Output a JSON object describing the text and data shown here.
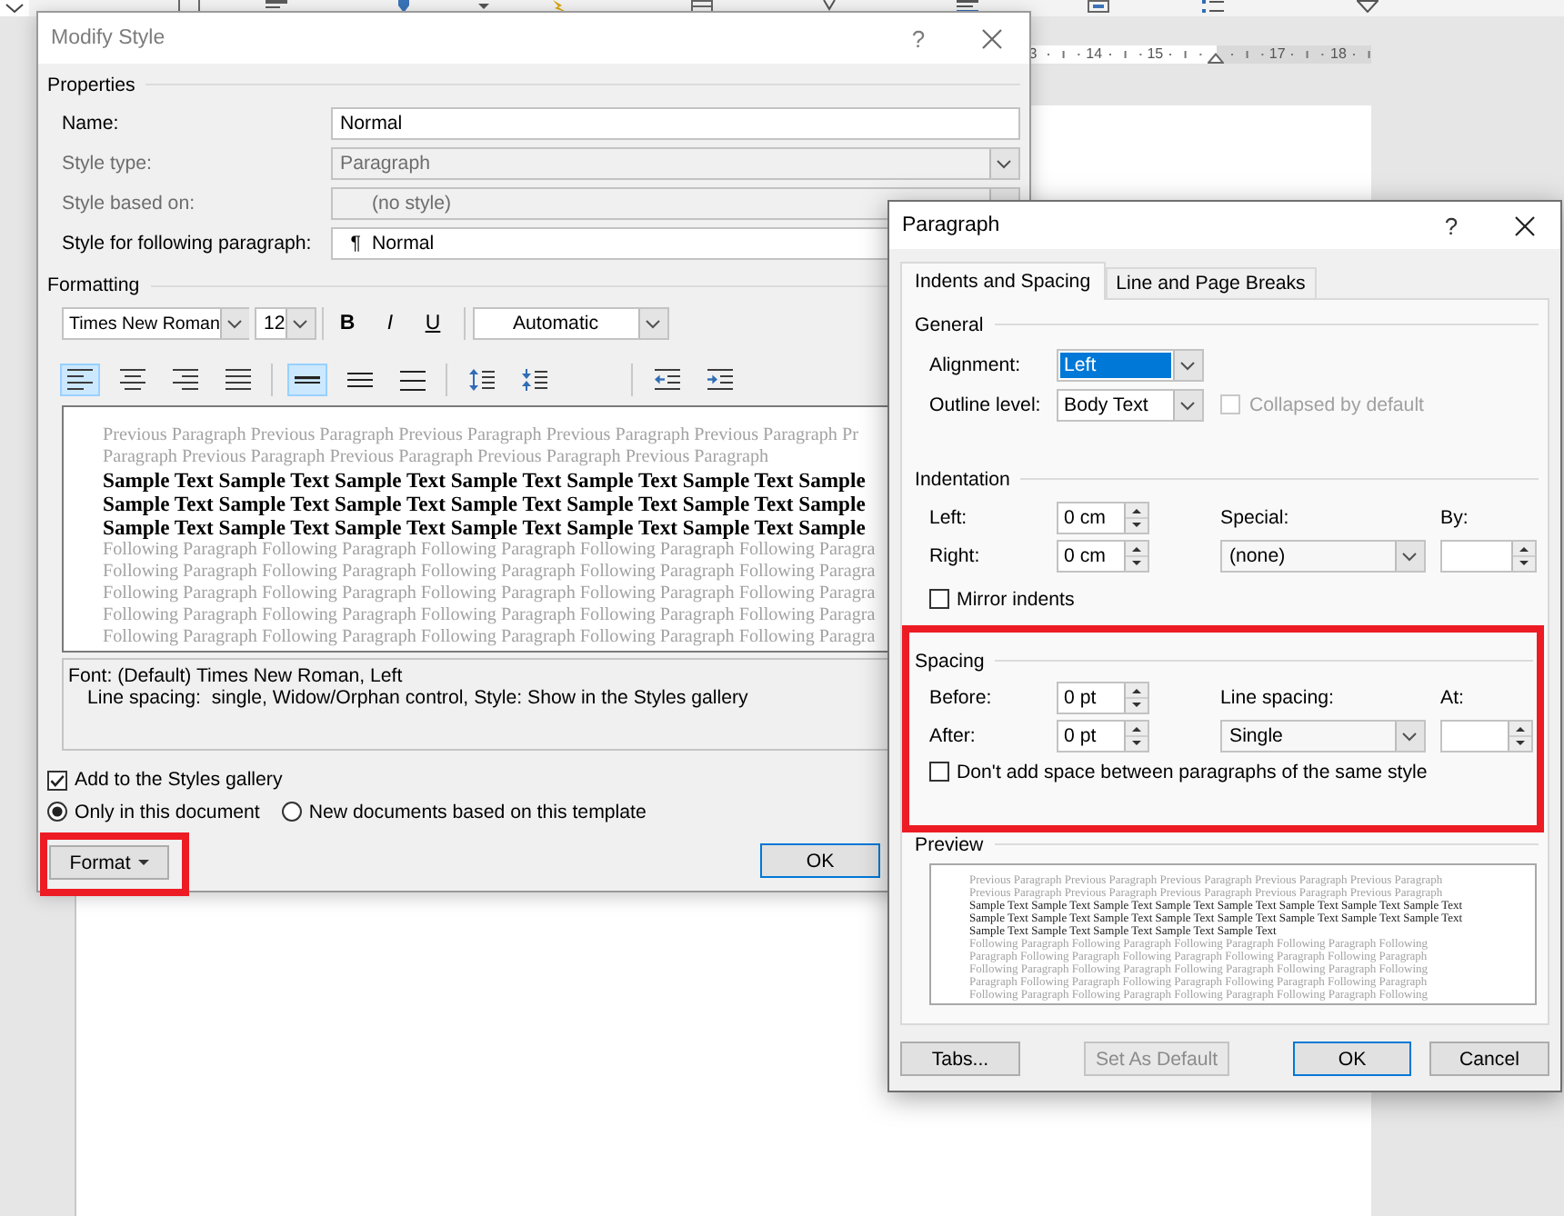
{
  "ruler": {
    "marks": [
      {
        "kind": "number",
        "text": "3"
      },
      {
        "kind": "number",
        "text": "14"
      },
      {
        "kind": "number",
        "text": "15"
      },
      {
        "kind": "indent_marker"
      },
      {
        "kind": "number",
        "text": "17"
      },
      {
        "kind": "number",
        "text": "18"
      }
    ]
  },
  "modify_style": {
    "title": "Modify Style",
    "help": "?",
    "properties": {
      "heading": "Properties",
      "fields": [
        {
          "kind": "text",
          "label": "Name:",
          "value": "Normal",
          "disabled": false
        },
        {
          "kind": "dropdown",
          "label": "Style type:",
          "value": "Paragraph",
          "disabled": true
        },
        {
          "kind": "style_dropdown",
          "label": "Style based on:",
          "value": "(no style)",
          "disabled": true
        },
        {
          "kind": "style_dropdown",
          "label": "Style for following paragraph:",
          "mark": "¶",
          "value": "Normal",
          "disabled": false
        }
      ]
    },
    "formatting": {
      "heading": "Formatting",
      "font": "Times New Roman",
      "size": "12",
      "styles": [
        {
          "kind": "bold",
          "label": "B"
        },
        {
          "kind": "italic",
          "label": "I"
        },
        {
          "kind": "underline",
          "label": "U"
        }
      ],
      "font_shade": "Automatic",
      "alignment": [
        {
          "kind": "left",
          "selected": true
        },
        {
          "kind": "center",
          "selected": false
        },
        {
          "kind": "right",
          "selected": false
        },
        {
          "kind": "justify",
          "selected": false
        }
      ],
      "line_spacing": [
        {
          "kind": "single",
          "selected": true
        },
        {
          "kind": "one_and_half",
          "selected": false
        },
        {
          "kind": "double",
          "selected": false
        }
      ],
      "spacing": [
        {
          "kind": "increase"
        },
        {
          "kind": "decrease"
        }
      ],
      "indent": [
        {
          "kind": "decrease"
        },
        {
          "kind": "increase"
        }
      ]
    },
    "preview": {
      "lines": [
        {
          "kind": "previous",
          "text": "Previous Paragraph Previous Paragraph Previous Paragraph Previous Paragraph Previous Paragraph Pr"
        },
        {
          "kind": "previous",
          "text": "Paragraph Previous Paragraph Previous Paragraph Previous Paragraph Previous Paragraph"
        },
        {
          "kind": "sample",
          "text": "Sample Text Sample Text Sample Text Sample Text Sample Text Sample Text Sample"
        },
        {
          "kind": "sample",
          "text": "Sample Text Sample Text Sample Text Sample Text Sample Text Sample Text Sample"
        },
        {
          "kind": "sample",
          "text": "Sample Text Sample Text Sample Text Sample Text Sample Text Sample Text Sample"
        },
        {
          "kind": "following",
          "text": "Following Paragraph Following Paragraph Following Paragraph Following Paragraph Following Paragra"
        },
        {
          "kind": "following",
          "text": "Following Paragraph Following Paragraph Following Paragraph Following Paragraph Following Paragra"
        },
        {
          "kind": "following",
          "text": "Following Paragraph Following Paragraph Following Paragraph Following Paragraph Following Paragra"
        },
        {
          "kind": "following",
          "text": "Following Paragraph Following Paragraph Following Paragraph Following Paragraph Following Paragra"
        },
        {
          "kind": "following",
          "text": "Following Paragraph Following Paragraph Following Paragraph Following Paragraph Following Paragra"
        }
      ]
    },
    "description": [
      "Font: (Default) Times New Roman, Left",
      "Line spacing:  single, Widow/Orphan control, Style: Show in the Styles gallery"
    ],
    "add_to_gallery": {
      "label": "Add to the Styles gallery",
      "checked": true
    },
    "scope": [
      {
        "label": "Only in this document",
        "selected": true
      },
      {
        "label": "New documents based on this template",
        "selected": false
      }
    ],
    "buttons": [
      {
        "kind": "format",
        "label": "Format",
        "menu": true,
        "default": false,
        "highlighted": true
      },
      {
        "kind": "ok",
        "label": "OK",
        "default": true
      }
    ]
  },
  "paragraph": {
    "title": "Paragraph",
    "help": "?",
    "tabs": [
      {
        "label": "Indents and Spacing",
        "selected": true
      },
      {
        "label": "Line and Page Breaks",
        "selected": false
      }
    ],
    "general": {
      "heading": "General",
      "alignment": {
        "label": "Alignment:",
        "value": "Left",
        "focused": true
      },
      "outline_level": {
        "label": "Outline level:",
        "value": "Body Text"
      },
      "collapsed": {
        "label": "Collapsed by default",
        "checked": false,
        "disabled": true
      }
    },
    "indentation": {
      "heading": "Indentation",
      "left": {
        "label": "Left:",
        "value": "0 cm"
      },
      "right": {
        "label": "Right:",
        "value": "0 cm"
      },
      "special": {
        "label": "Special:",
        "value": "(none)"
      },
      "by": {
        "label": "By:"
      },
      "mirror": {
        "label": "Mirror indents",
        "checked": false
      }
    },
    "spacing": {
      "heading": "Spacing",
      "highlighted": true,
      "before": {
        "label": "Before:",
        "value": "0 pt"
      },
      "after": {
        "label": "After:",
        "value": "0 pt"
      },
      "line_spacing": {
        "label": "Line spacing:",
        "value": "Single"
      },
      "at": {
        "label": "At:"
      },
      "dont_add": {
        "label": "Don't add space between paragraphs of the same style",
        "checked": false
      }
    },
    "preview": {
      "heading": "Preview",
      "lines": [
        {
          "kind": "previous",
          "text": "Previous Paragraph Previous Paragraph Previous Paragraph Previous Paragraph Previous Paragraph"
        },
        {
          "kind": "previous",
          "text": "Previous Paragraph Previous Paragraph Previous Paragraph Previous Paragraph Previous Paragraph"
        },
        {
          "kind": "sample",
          "text": "Sample Text Sample Text Sample Text Sample Text Sample Text Sample Text Sample Text Sample Text"
        },
        {
          "kind": "sample",
          "text": "Sample Text Sample Text Sample Text Sample Text Sample Text Sample Text Sample Text Sample Text"
        },
        {
          "kind": "sample",
          "text": "Sample Text Sample Text Sample Text Sample Text Sample Text"
        },
        {
          "kind": "following",
          "text": "Following Paragraph Following Paragraph Following Paragraph Following Paragraph Following"
        },
        {
          "kind": "following",
          "text": "Paragraph Following Paragraph Following Paragraph Following Paragraph Following Paragraph"
        },
        {
          "kind": "following",
          "text": "Following Paragraph Following Paragraph Following Paragraph Following Paragraph Following"
        },
        {
          "kind": "following",
          "text": "Paragraph Following Paragraph Following Paragraph Following Paragraph Following Paragraph"
        },
        {
          "kind": "following",
          "text": "Following Paragraph Following Paragraph Following Paragraph Following Paragraph Following"
        }
      ]
    },
    "buttons": [
      {
        "kind": "tabs",
        "label": "Tabs...",
        "default": false,
        "disabled": false
      },
      {
        "kind": "set_default",
        "label": "Set As Default",
        "default": false,
        "disabled": true
      },
      {
        "kind": "ok",
        "label": "OK",
        "default": true,
        "disabled": false
      },
      {
        "kind": "cancel",
        "label": "Cancel",
        "default": false,
        "disabled": false
      }
    ]
  }
}
